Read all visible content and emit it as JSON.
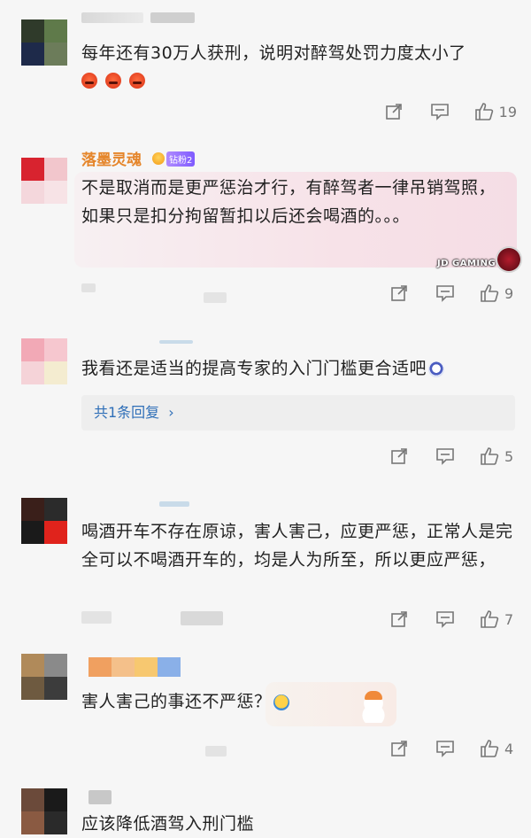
{
  "comments": [
    {
      "id": "c1",
      "text": "每年还有30万人获刑，说明对醉驾处罚力度太小了",
      "reaction_emojis": [
        "angry-face",
        "angry-face",
        "angry-face"
      ],
      "likes": "19"
    },
    {
      "id": "c2",
      "username": "落墨灵魂",
      "badge": "钻粉2",
      "text": "不是取消而是更严惩治才行，有醉驾者一律吊销驾照，如果只是扣分拘留暂扣以后还会喝酒的。。。",
      "bubble_brand": "JD GAMING",
      "likes": "9"
    },
    {
      "id": "c3",
      "text": "我看还是适当的提高专家的入门门槛更合适吧",
      "reply_link": "共1条回复",
      "likes": "5"
    },
    {
      "id": "c4",
      "text": "喝酒开车不存在原谅，害人害己，应更严惩，正常人是完全可以不喝酒开车的，均是人为所至，所以更应严惩，",
      "likes": "7"
    },
    {
      "id": "c5",
      "text": "害人害己的事还不严惩？",
      "likes": "4"
    },
    {
      "id": "c6",
      "text": "应该降低酒驾入刑门槛"
    }
  ],
  "icons": {
    "share": "share-icon",
    "comment": "comment-icon",
    "like": "thumbs-up-icon"
  },
  "colors": {
    "username": "#e5862b",
    "link": "#2f6fb8",
    "background": "#f6f6f6"
  }
}
